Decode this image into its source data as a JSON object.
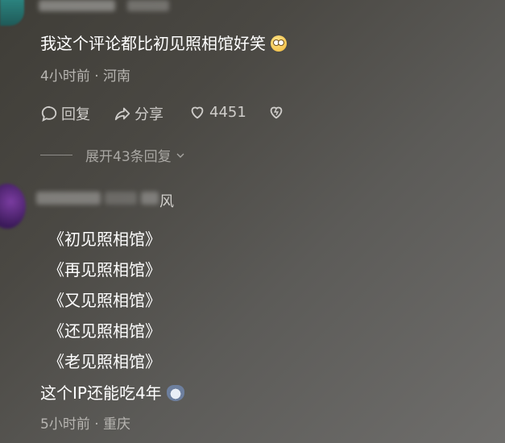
{
  "comment1": {
    "text": "我这个评论都比初见照相馆好笑",
    "meta": "4小时前 · 河南",
    "actions": {
      "reply_label": "回复",
      "share_label": "分享",
      "like_count": "4451"
    },
    "expand_label": "展开43条回复"
  },
  "comment2": {
    "username_visible_end": "风",
    "lines": [
      "《初见照相馆》",
      "《再见照相馆》",
      "《又见照相馆》",
      "《还见照相馆》",
      "《老见照相馆》"
    ],
    "last_line": "这个IP还能吃4年",
    "meta": "5小时前 · 重庆"
  }
}
